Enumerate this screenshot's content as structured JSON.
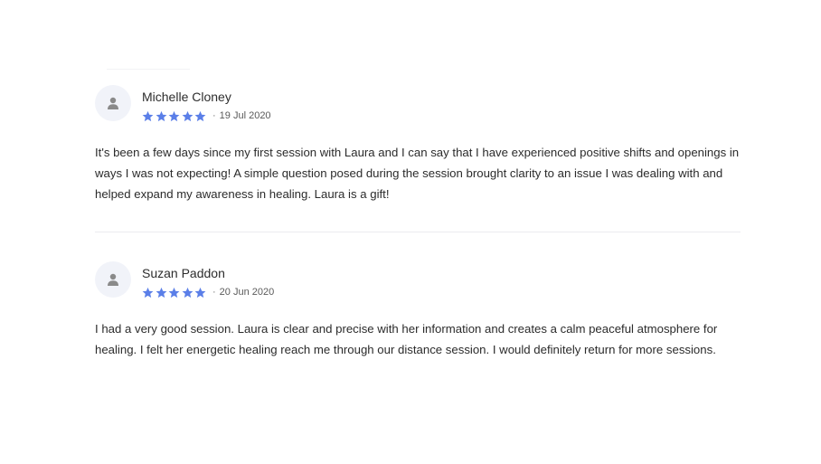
{
  "colors": {
    "star": "#5b7fe8",
    "avatar_bg": "#f1f3f9",
    "avatar_icon": "#8a8a8a",
    "divider": "#ececef"
  },
  "reviews": [
    {
      "name": "Michelle Cloney",
      "rating": 5,
      "separator": "·",
      "date": "19 Jul 2020",
      "text": "It's been a few days since my first session with Laura and I can say that I have experienced positive shifts and openings in ways I was not expecting! A simple question posed during the session brought clarity to an issue I was dealing with and helped expand my awareness in healing. Laura is a gift!",
      "avatar_icon": "user-icon",
      "star_icon": "star-icon"
    },
    {
      "name": "Suzan Paddon",
      "rating": 5,
      "separator": "·",
      "date": "20 Jun 2020",
      "text": "I had a very good session. Laura is clear and precise with her information and creates a calm peaceful atmosphere for healing. I felt her energetic healing reach me through our distance session. I would definitely return for more sessions.",
      "avatar_icon": "user-icon",
      "star_icon": "star-icon"
    }
  ]
}
